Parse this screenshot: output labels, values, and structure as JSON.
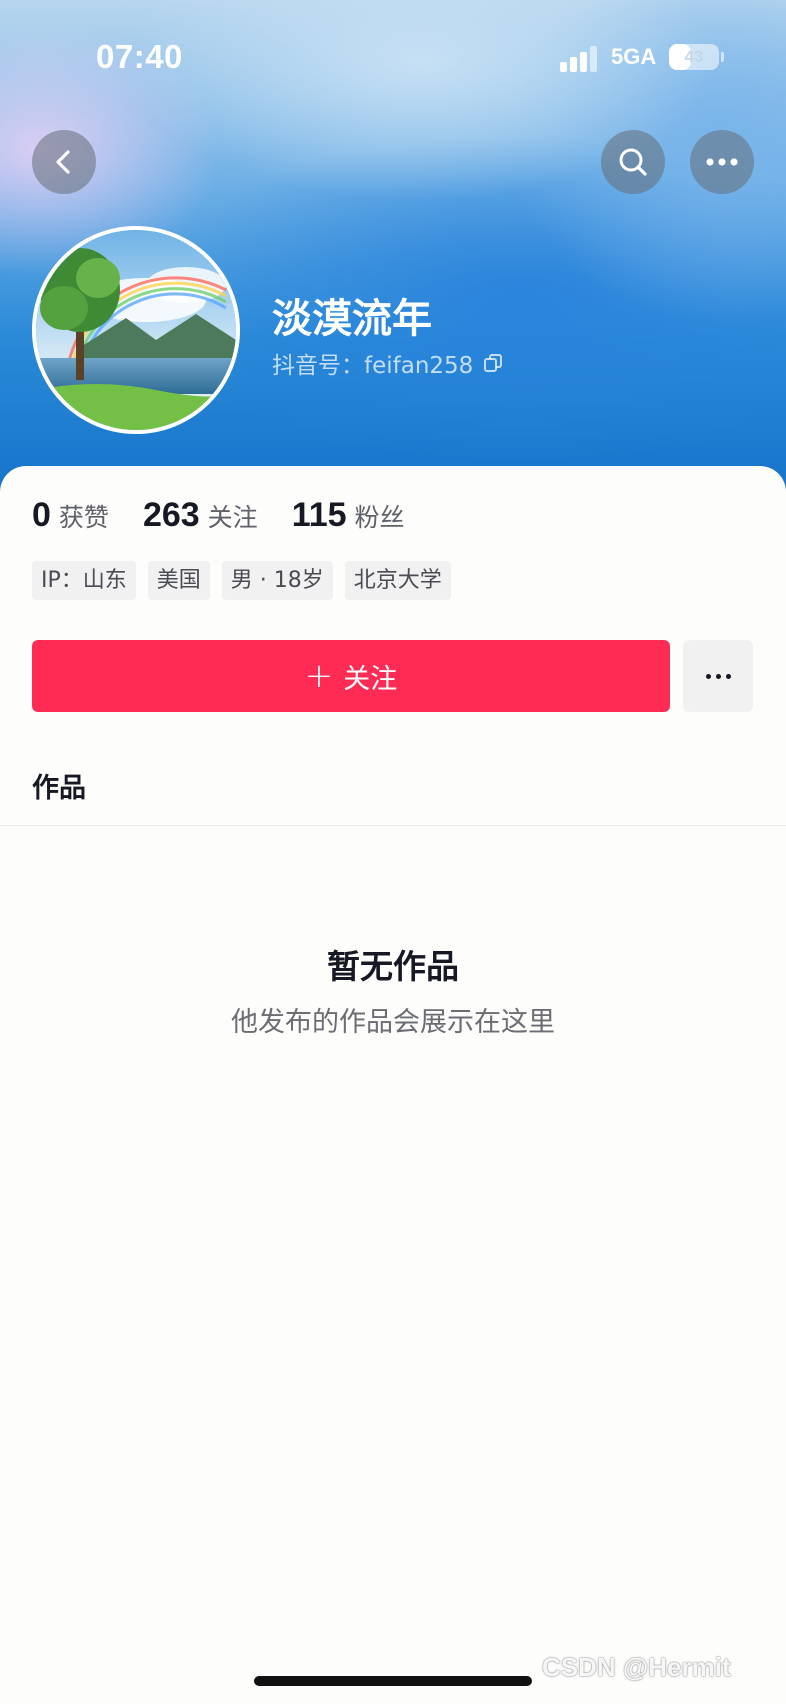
{
  "status_bar": {
    "time": "07:40",
    "network": "5GA",
    "battery": "43",
    "battery_level": 0.43
  },
  "header": {
    "back_icon": "chevron-left-icon",
    "search_icon": "search-icon",
    "more_icon": "more-horizontal-icon"
  },
  "profile": {
    "name": "淡漠流年",
    "douyin_id_label": "抖音号：",
    "douyin_id": "feifan258",
    "copy_icon": "copy-icon",
    "avatar": "avatar-landscape-rainbow"
  },
  "stats": [
    {
      "value": "0",
      "label": "获赞"
    },
    {
      "value": "263",
      "label": "关注"
    },
    {
      "value": "115",
      "label": "粉丝"
    }
  ],
  "tags": [
    "IP：山东",
    "美国",
    "男 · 18岁",
    "北京大学"
  ],
  "actions": {
    "follow_plus": "+",
    "follow_label": "关注",
    "more_icon": "ellipsis-icon"
  },
  "tabs": {
    "works": "作品"
  },
  "empty_state": {
    "title": "暂无作品",
    "subtitle": "他发布的作品会展示在这里"
  },
  "watermark": "CSDN @Hermit",
  "colors": {
    "accent": "#fe2c55",
    "tag_bg": "#f1f1f2",
    "header_blue": "#1270c8"
  }
}
